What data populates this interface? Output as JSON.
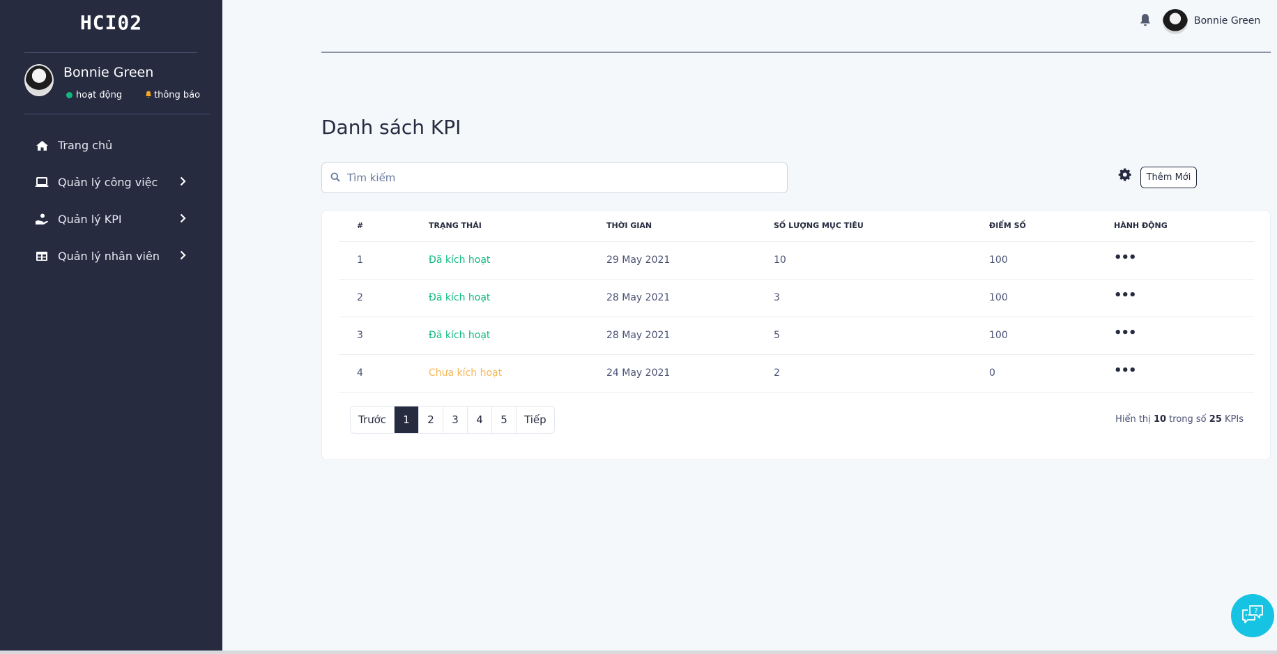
{
  "sidebar": {
    "brand": "HCI02",
    "user_name": "Bonnie Green",
    "status_online": "hoạt động",
    "status_notify": "thông báo",
    "items": [
      {
        "label": "Trang chủ",
        "icon": "home-icon"
      },
      {
        "label": "Quản lý công việc",
        "icon": "laptop-icon"
      },
      {
        "label": "Quản lý KPI",
        "icon": "hand-coin-icon"
      },
      {
        "label": "Quản lý nhân viên",
        "icon": "table-icon"
      }
    ]
  },
  "topbar": {
    "user_name": "Bonnie Green"
  },
  "main": {
    "title": "Danh sách KPI",
    "search_placeholder": "Tìm kiếm",
    "add_label": "Thêm Mới",
    "columns": [
      "#",
      "Trạng thái",
      "Thời gian",
      "Số lượng mục tiêu",
      "Điểm số",
      "Hành động"
    ],
    "rows": [
      {
        "id": "1",
        "status": "Đã kích hoạt",
        "time": "29 May 2021",
        "targets": "10",
        "score": "100",
        "action": "•••"
      },
      {
        "id": "2",
        "status": "Đã kích hoạt",
        "time": "28 May 2021",
        "targets": "3",
        "score": "100",
        "action": "•••"
      },
      {
        "id": "3",
        "status": "Đã kích hoạt",
        "time": "28 May 2021",
        "targets": "5",
        "score": "100",
        "action": "•••"
      },
      {
        "id": "4",
        "status": "Chưa kích hoạt",
        "time": "24 May 2021",
        "targets": "2",
        "score": "0",
        "action": "•••"
      }
    ],
    "pagination": {
      "prev": "Trước",
      "pages": [
        "1",
        "2",
        "3",
        "4",
        "5"
      ],
      "current": "1",
      "next": "Tiếp"
    },
    "summary": {
      "prefix": "Hiển thị",
      "shown": "10",
      "middle": "trong số",
      "total": "25",
      "suffix": "KPIs"
    }
  },
  "colors": {
    "sidebar_bg": "#262b40",
    "active_status": "#10b981",
    "inactive_status": "#f5b759",
    "chat_button": "#17c3e2"
  }
}
